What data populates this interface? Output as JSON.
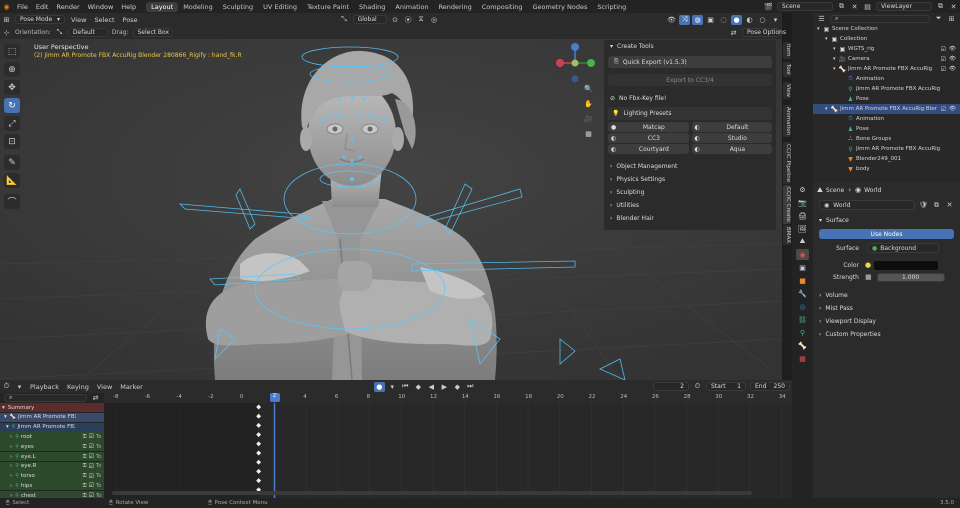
{
  "topbar": {
    "menus": [
      "File",
      "Edit",
      "Render",
      "Window",
      "Help"
    ],
    "workspaces": [
      "Layout",
      "Modeling",
      "Sculpting",
      "UV Editing",
      "Texture Paint",
      "Shading",
      "Animation",
      "Rendering",
      "Compositing",
      "Geometry Nodes",
      "Scripting"
    ],
    "active_workspace": "Layout",
    "scene_label": "Scene",
    "view_layer_label": "ViewLayer"
  },
  "viewport_header": {
    "mode": "Pose Mode",
    "menus": [
      "View",
      "Select",
      "Pose"
    ],
    "transform_orientation": "Global",
    "pose_options": "Pose Options"
  },
  "tool_header": {
    "orientation_label": "Orientation:",
    "orientation_value": "Default",
    "drag_label": "Drag:",
    "drag_value": "Select Box"
  },
  "viewport": {
    "view_name": "User Perspective",
    "active_info": "(2) Jimm AR Promote FBX AccuRig Blender 280866_Rigify : hand_fk.R",
    "gizmo_axes": [
      "Z",
      "Y",
      "X"
    ]
  },
  "npanel": {
    "create_tools_label": "Create Tools",
    "quick_export": "Quick Export (v1.5.3)",
    "export_cc": "Export to CC3/4",
    "no_fbx": "No Fbx-Key file!",
    "lighting_presets": "Lighting Presets",
    "presets": [
      "Matcap",
      "Default",
      "CC3",
      "Studio",
      "Courtyard",
      "Aqua"
    ],
    "sections": [
      "Object Management",
      "Physics Settings",
      "Sculpting",
      "Utilities",
      "Blender Hair"
    ]
  },
  "side_tabs": [
    "Item",
    "Tool",
    "View",
    "Animation",
    "CC/iC Pipeline",
    "CC/iC Create",
    "BMAX"
  ],
  "outliner": {
    "rows": [
      {
        "label": "Scene Collection",
        "indent": 0,
        "icon": "scene-collection-icon"
      },
      {
        "label": "Collection",
        "indent": 1,
        "icon": "collection-icon"
      },
      {
        "label": "WGTS_rig",
        "indent": 2,
        "icon": "collection-icon"
      },
      {
        "label": "Camera",
        "indent": 2,
        "icon": "camera-icon"
      },
      {
        "label": "Jimm AR Promote FBX AccuRig",
        "indent": 2,
        "icon": "armature-icon"
      },
      {
        "label": "Animation",
        "indent": 3,
        "icon": "animation-icon"
      },
      {
        "label": "Jimm AR Promote FBX AccuRig",
        "indent": 3,
        "icon": "armature-data-icon"
      },
      {
        "label": "Pose",
        "indent": 3,
        "icon": "pose-icon"
      },
      {
        "label": "Jimm AR Promote FBX AccuRig Bler",
        "indent": 1,
        "icon": "armature-icon",
        "selected": true
      },
      {
        "label": "Animation",
        "indent": 3,
        "icon": "animation-icon"
      },
      {
        "label": "Pose",
        "indent": 3,
        "icon": "pose-icon"
      },
      {
        "label": "Bone Groups",
        "indent": 3,
        "icon": "bone-groups-icon"
      },
      {
        "label": "Jimm AR Promote FBX AccuRig",
        "indent": 3,
        "icon": "armature-data-icon"
      },
      {
        "label": "Blender249_001",
        "indent": 3,
        "icon": "mesh-icon"
      },
      {
        "label": "body",
        "indent": 3,
        "icon": "mesh-icon"
      }
    ]
  },
  "properties": {
    "breadcrumb_scene": "Scene",
    "breadcrumb_world": "World",
    "world_name": "World",
    "surface_label": "Surface",
    "use_nodes": "Use Nodes",
    "surface_field_label": "Surface",
    "surface_value": "Background",
    "color_label": "Color",
    "strength_label": "Strength",
    "strength_value": "1.000",
    "sections": [
      "Volume",
      "Mist Pass",
      "Viewport Display",
      "Custom Properties"
    ]
  },
  "timeline": {
    "menus": [
      "Playback",
      "Keying",
      "View",
      "Marker"
    ],
    "current_frame": "2",
    "start_label": "Start",
    "start_value": "1",
    "end_label": "End",
    "end_value": "250",
    "ruler": [
      "-8",
      "-6",
      "-4",
      "-2",
      "0",
      "2",
      "4",
      "6",
      "8",
      "10",
      "12",
      "14",
      "16",
      "18",
      "20",
      "22",
      "24",
      "26",
      "28",
      "30",
      "32",
      "34"
    ],
    "channels": [
      {
        "label": "Summary",
        "type": "summary"
      },
      {
        "label": "Jimm AR Promote FBX AccuRig B",
        "type": "object"
      },
      {
        "label": "Jimm AR Promote FBX AccuRig",
        "type": "action"
      },
      {
        "label": "root",
        "type": "bone"
      },
      {
        "label": "eyes",
        "type": "bone"
      },
      {
        "label": "eye.L",
        "type": "bone"
      },
      {
        "label": "eye.R",
        "type": "bone"
      },
      {
        "label": "torso",
        "type": "bone"
      },
      {
        "label": "hips",
        "type": "bone"
      },
      {
        "label": "chest",
        "type": "bone"
      }
    ],
    "group_tag": "To"
  },
  "statusbar": {
    "select": "Select",
    "rotate": "Rotate View",
    "context": "Pose Context Menu",
    "version": "3.5.0"
  },
  "colors": {
    "accent_blue": "#4772b3",
    "selected_row": "#334d80",
    "rig_cyan": "#56c8ff",
    "playhead": "#4a7cd1"
  }
}
